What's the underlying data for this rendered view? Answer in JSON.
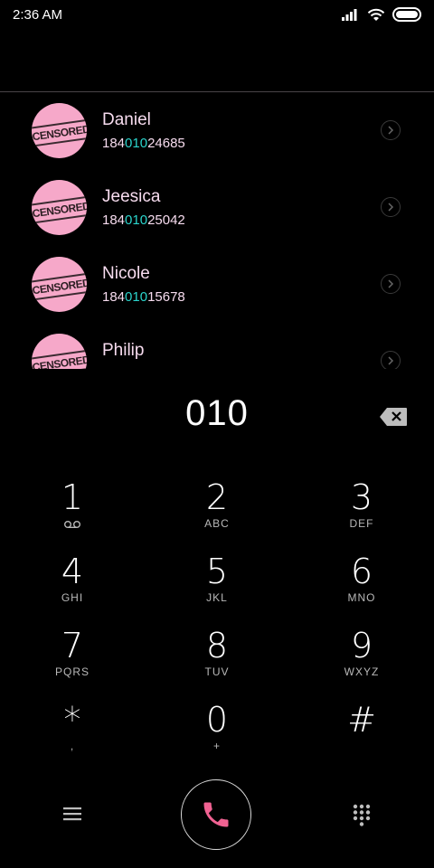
{
  "status_bar": {
    "time": "2:36 AM"
  },
  "contacts": [
    {
      "name": "Daniel",
      "num_pre": "184",
      "num_match": "010",
      "num_post": "24685"
    },
    {
      "name": "Jeesica",
      "num_pre": "184",
      "num_match": "010",
      "num_post": "25042"
    },
    {
      "name": "Nicole",
      "num_pre": "184",
      "num_match": "010",
      "num_post": "15678"
    },
    {
      "name": "Philip",
      "num_pre": "",
      "num_match": "",
      "num_post": ""
    }
  ],
  "avatar_stamp_text": "CENSORED",
  "dialer": {
    "entered_number": "010"
  },
  "keypad": [
    {
      "digit": "1",
      "letters": "voicemail-icon"
    },
    {
      "digit": "2",
      "letters": "ABC"
    },
    {
      "digit": "3",
      "letters": "DEF"
    },
    {
      "digit": "4",
      "letters": "GHI"
    },
    {
      "digit": "5",
      "letters": "JKL"
    },
    {
      "digit": "6",
      "letters": "MNO"
    },
    {
      "digit": "7",
      "letters": "PQRS"
    },
    {
      "digit": "8",
      "letters": "TUV"
    },
    {
      "digit": "9",
      "letters": "WXYZ"
    },
    {
      "digit": "*",
      "letters": ","
    },
    {
      "digit": "0",
      "letters": "+"
    },
    {
      "digit": "#",
      "letters": ""
    }
  ],
  "colors": {
    "accent_pink": "#f06292",
    "match_cyan": "#2bd4cc",
    "avatar_pink": "#f6a8c9"
  },
  "icons": [
    "signal-icon",
    "wifi-icon",
    "battery-icon",
    "chevron-right-icon",
    "backspace-icon",
    "menu-icon",
    "phone-icon",
    "dialpad-icon",
    "voicemail-icon"
  ]
}
